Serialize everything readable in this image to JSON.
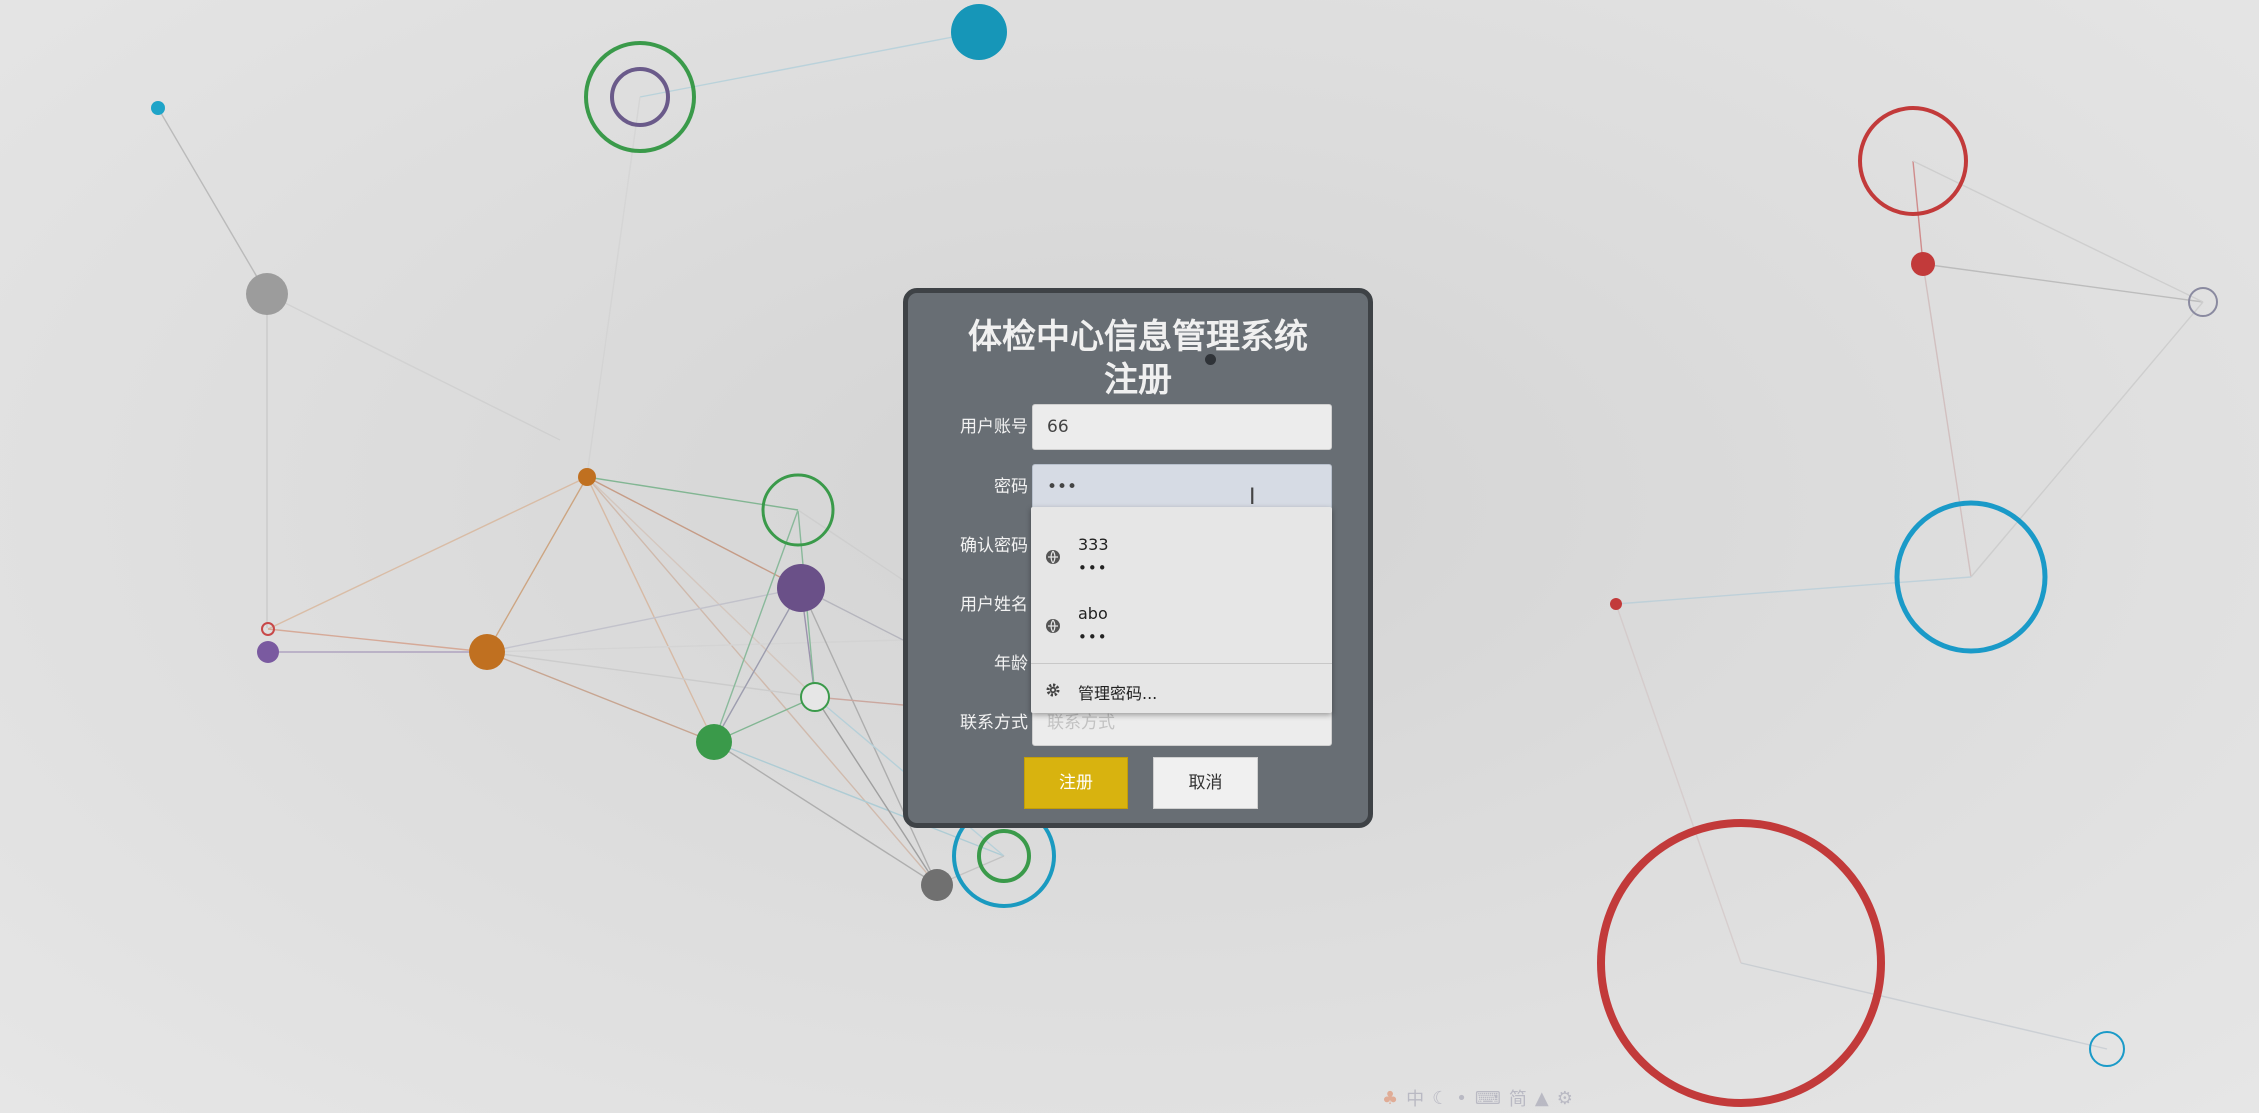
{
  "app": {
    "title_line1": "体检中心信息管理系统",
    "title_line2": "注册"
  },
  "form": {
    "account": {
      "label": "用户账号",
      "value": "66"
    },
    "password": {
      "label": "密码",
      "value": "•••"
    },
    "confirm_password": {
      "label": "确认密码"
    },
    "user_name": {
      "label": "用户姓名"
    },
    "age": {
      "label": "年龄"
    },
    "contact": {
      "label": "联系方式",
      "placeholder": "联系方式"
    }
  },
  "buttons": {
    "register": "注册",
    "cancel": "取消"
  },
  "autofill": {
    "suggestions": [
      {
        "username": "333",
        "password": "•••"
      },
      {
        "username": "abo",
        "password": "•••"
      }
    ],
    "manage_label": "管理密码..."
  },
  "taskbar": {
    "icons": [
      "ime-logo-icon",
      "chinese-mode-icon",
      "moon-icon",
      "punctuation-icon",
      "keyboard-icon",
      "simplified-icon",
      "shirt-icon",
      "settings-icon"
    ],
    "ime_mode": "中",
    "simplified": "简"
  },
  "colors": {
    "panel": "#686e74",
    "register_button": "#d8b30f",
    "background": "#dcdcdc"
  }
}
